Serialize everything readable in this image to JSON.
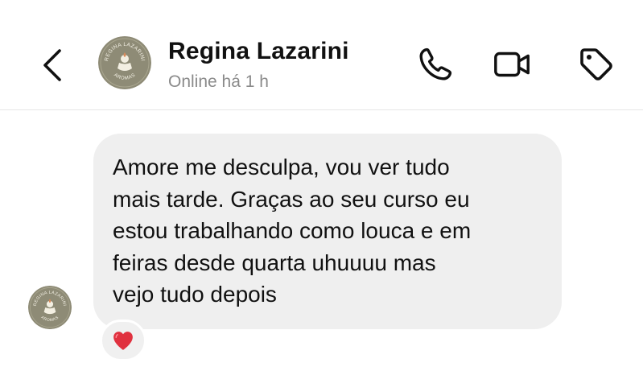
{
  "header": {
    "contact_name": "Regina Lazarini",
    "status": "Online há 1 h",
    "avatar_text_top": "REGINA LAZARINI",
    "avatar_text_bottom": "AROMAS",
    "icons": [
      "back-chevron-icon",
      "phone-icon",
      "video-camera-icon",
      "tag-icon"
    ]
  },
  "message": {
    "text": "Amore me desculpa, vou ver tudo\nmais tarde. Graças ao seu curso eu\nestou trabalhando como louca e em\nfeiras desde quarta uhuuuu mas\nvejo tudo depois",
    "reaction": "❤️"
  },
  "colors": {
    "bubble": "#efefef",
    "status_text": "#8a8a8a",
    "avatar_bg": "#8e8b76",
    "reaction_heart": "#e0313f"
  }
}
